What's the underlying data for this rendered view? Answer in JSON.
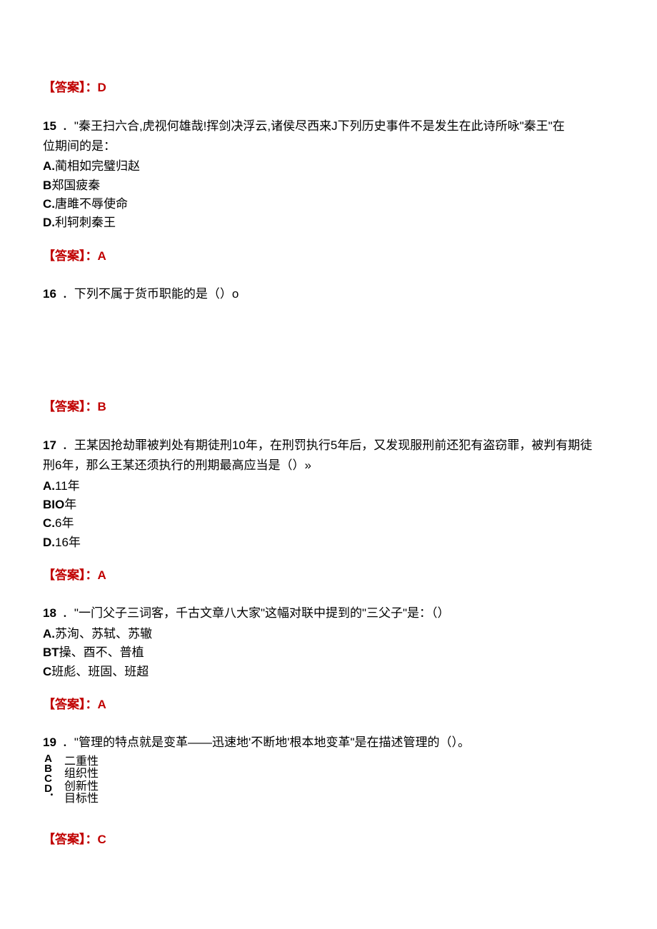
{
  "answers": {
    "prefix": "【答案】：",
    "a14": "D",
    "a15": "A",
    "a16": "B",
    "a17": "A",
    "a18": "A",
    "a19": "C"
  },
  "q15": {
    "num": "15",
    "dot": "．",
    "stem1": "\"秦王扫六合,虎视何雄哉!挥剑决浮云,诸侯尽西来J下列历史事件不是发生在此诗所咏\"秦王\"在",
    "stem2": "位期间的是：",
    "opts": {
      "A": "蔺相如完璧归赵",
      "Blabel": "B",
      "B": "郑国疲秦",
      "C": "唐雎不辱使命",
      "D": "利轲刺秦王"
    }
  },
  "q16": {
    "num": "16",
    "dot": "．",
    "stem": "下列不属于货币职能的是（）o"
  },
  "q17": {
    "num": "17",
    "dot": "．",
    "stem1": "王某因抢劫罪被判处有期徒刑10年，在刑罚执行5年后，又发现服刑前还犯有盗窃罪，被判有期徒",
    "stem2": "刑6年，那么王某还须执行的刑期最高应当是（）»",
    "opts": {
      "A": "11年",
      "Blabel": "BIO",
      "B": "年",
      "C": "6年",
      "D": "16年"
    }
  },
  "q18": {
    "num": "18",
    "dot": "．",
    "stem": "\"一门父子三词客，千古文章八大家\"这幅对联中提到的\"三父子\"是：（）",
    "opts": {
      "A": "苏洵、苏轼、苏辙",
      "Blabel": "BT",
      "B": "操、酉不、普植",
      "Clabel": "C",
      "C": "班彪、班固、班超"
    }
  },
  "q19": {
    "num": "19",
    "dot": "．",
    "stem": "\"管理的特点就是变革——迅速地'不断地'根本地变革\"是在描述管理的（）。",
    "stacked_label": "ABCD．",
    "opts": {
      "A": "二重性",
      "B": "组织性",
      "C": "创新性",
      "D": "目标性"
    }
  }
}
